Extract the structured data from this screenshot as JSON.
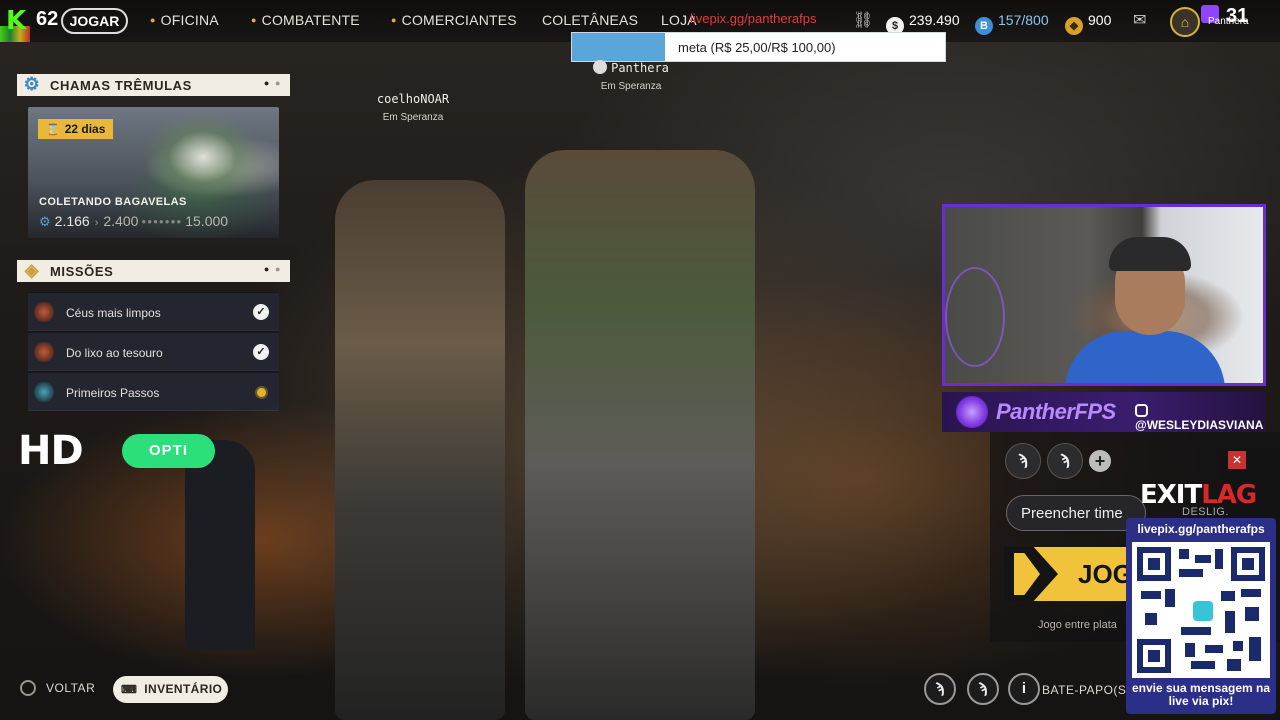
{
  "topbar": {
    "level": "62",
    "tabs": [
      "JOGAR",
      "OFICINA",
      "COMBATENTE",
      "COMERCIANTES",
      "COLETÂNEAS",
      "LOJA"
    ],
    "overlay_url": "livepix.gg/pantherafps",
    "currencies": {
      "coins": "239.490",
      "battlepass": "157/800",
      "premium": "900"
    },
    "twitch_count": "31",
    "twitch_name": "Panthera"
  },
  "meta_goal": {
    "text": "meta (R$ 25,00/R$ 100,00)",
    "progress_percent": 25
  },
  "players": [
    {
      "name": "coelhoNOAR",
      "location": "Em Speranza"
    },
    {
      "name": "Panthera",
      "location": "Em Speranza"
    }
  ],
  "event_panel": {
    "header": "CHAMAS TRÊMULAS",
    "days": "22 dias",
    "title": "COLETANDO BAGAVELAS",
    "current": "2.166",
    "next": "2.400",
    "max": "15.000"
  },
  "missions_panel": {
    "header": "MISSÕES",
    "items": [
      {
        "label": "Céus mais limpos",
        "status": "done"
      },
      {
        "label": "Do lixo ao tesouro",
        "status": "done"
      },
      {
        "label": "Primeiros Passos",
        "status": "pending"
      }
    ]
  },
  "hd_badge": {
    "hd": "HD",
    "opti": "OPTI"
  },
  "bottom_left": {
    "back": "VOLTAR",
    "inventory": "INVENTÁRIO"
  },
  "stream_overlay": {
    "brand_name": "PantherFPS",
    "instagram": "@WESLEYDIASVIANA",
    "exitlag_exit": "EXIT",
    "exitlag_lag": "LAG",
    "qr_title": "livepix.gg/pantherafps",
    "qr_footer_1": "envie sua mensagem na",
    "qr_footer_2": "live via pix!"
  },
  "lobby": {
    "fill_team": "Preencher time",
    "toggle": "DESLIG.",
    "play": "JOG",
    "crossplay": "Jogo entre plata"
  },
  "bottom_right": {
    "chat": "BATE-PAPO(S"
  },
  "colors": {
    "accent_gold": "#f0c33a",
    "brand_purple": "#6b2bd6",
    "qr_blue": "#2b2f87",
    "kick_green": "#53fc18"
  }
}
